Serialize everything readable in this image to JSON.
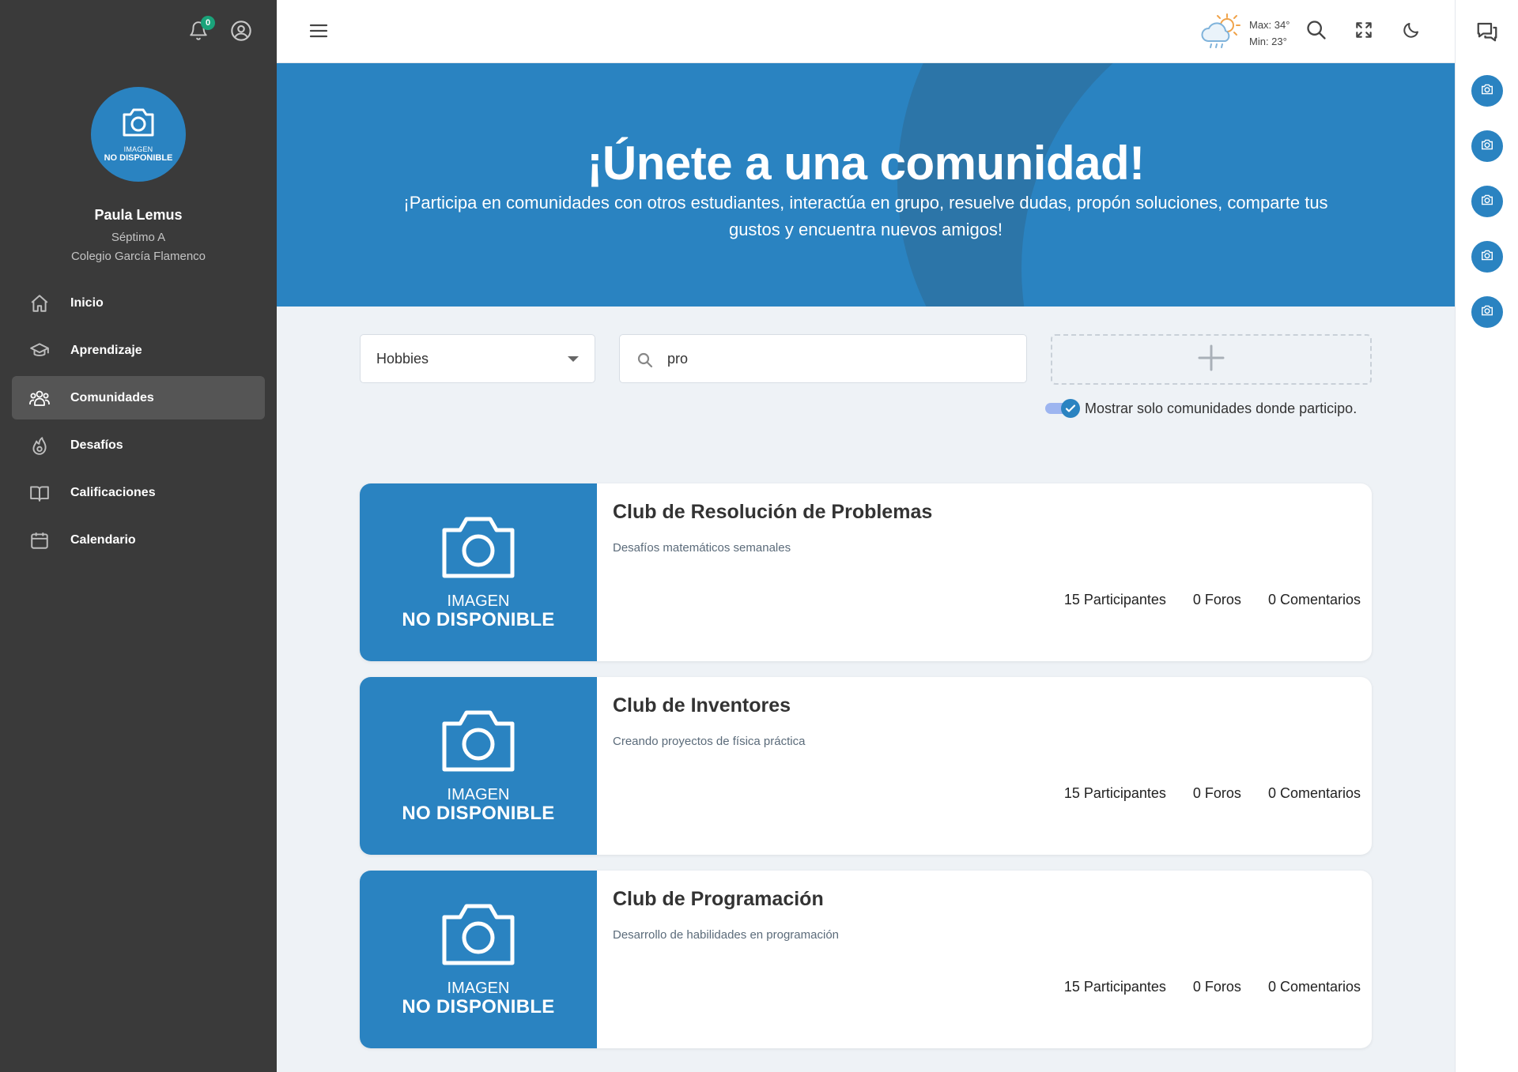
{
  "sidebar": {
    "notification_count": "0",
    "avatar": {
      "caption_top": "IMAGEN",
      "caption_bottom": "NO DISPONIBLE"
    },
    "user": {
      "name": "Paula Lemus",
      "grade": "Séptimo A",
      "school": "Colegio García Flamenco"
    },
    "nav": [
      {
        "label": "Inicio",
        "icon": "home-icon",
        "active": false
      },
      {
        "label": "Aprendizaje",
        "icon": "graduation-cap-icon",
        "active": false
      },
      {
        "label": "Comunidades",
        "icon": "users-icon",
        "active": true
      },
      {
        "label": "Desafíos",
        "icon": "flame-icon",
        "active": false
      },
      {
        "label": "Calificaciones",
        "icon": "book-icon",
        "active": false
      },
      {
        "label": "Calendario",
        "icon": "calendar-icon",
        "active": false
      }
    ]
  },
  "topbar": {
    "weather": {
      "max": "Max: 34°",
      "min": "Min: 23°",
      "icon": "partly-cloudy-rain-icon"
    },
    "icons": [
      "menu-icon",
      "search-icon",
      "fullscreen-icon",
      "moon-icon"
    ]
  },
  "rightrail": {
    "chat_icon": "chat-icon",
    "participant_count_shown": 5
  },
  "hero": {
    "title": "¡Únete a una comunidad!",
    "subtitle": "¡Participa en comunidades con otros estudiantes, interactúa en grupo, resuelve dudas, propón soluciones, comparte tus gustos y encuentra nuevos amigos!"
  },
  "filters": {
    "category_selected": "Hobbies",
    "search_value": "pro",
    "toggle_label": "Mostrar solo comunidades donde participo.",
    "toggle_on": true
  },
  "colors": {
    "primary": "#2a83c1",
    "sidebar_bg": "#3a3a3a",
    "active_nav": "#555555",
    "badge": "#1aa37a"
  },
  "communities": [
    {
      "title": "Club de Resolución de Problemas",
      "description": "Desafíos matemáticos semanales",
      "participants": "15 Participantes",
      "forums": "0 Foros",
      "comments": "0 Comentarios",
      "image_caption_top": "IMAGEN",
      "image_caption_bottom": "NO DISPONIBLE"
    },
    {
      "title": "Club de Inventores",
      "description": "Creando proyectos de física práctica",
      "participants": "15 Participantes",
      "forums": "0 Foros",
      "comments": "0 Comentarios",
      "image_caption_top": "IMAGEN",
      "image_caption_bottom": "NO DISPONIBLE"
    },
    {
      "title": "Club de Programación",
      "description": "Desarrollo de habilidades en programación",
      "participants": "15 Participantes",
      "forums": "0 Foros",
      "comments": "0 Comentarios",
      "image_caption_top": "IMAGEN",
      "image_caption_bottom": "NO DISPONIBLE"
    }
  ]
}
